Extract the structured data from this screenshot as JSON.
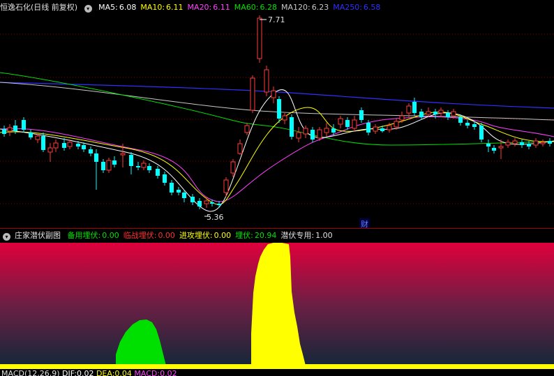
{
  "main": {
    "stock_name": "恒逸石化",
    "period": "(日线 前复权)",
    "ma": [
      {
        "label": "MA5:",
        "value": "6.08",
        "color": "#ffffff"
      },
      {
        "label": "MA10:",
        "value": "6.11",
        "color": "#ffff00"
      },
      {
        "label": "MA20:",
        "value": "6.11",
        "color": "#ff40ff"
      },
      {
        "label": "MA60:",
        "value": "6.28",
        "color": "#00e000"
      },
      {
        "label": "MA120:",
        "value": "6.23",
        "color": "#c8c8c8"
      },
      {
        "label": "MA250:",
        "value": "6.58",
        "color": "#3030ff"
      }
    ],
    "high_label": "7.71",
    "low_label": "5.36",
    "finance_marker": "财"
  },
  "sub": {
    "title": "庄家潜伏副图",
    "items": [
      {
        "label": "备用埋伏:",
        "value": "0.00",
        "color": "#00e000"
      },
      {
        "label": "临战埋伏:",
        "value": "0.00",
        "color": "#ff3030"
      },
      {
        "label": "进攻埋伏:",
        "value": "0.00",
        "color": "#ffff00"
      },
      {
        "label": "埋伏:",
        "value": "20.94",
        "color": "#00e000"
      },
      {
        "label": "潜伏专用:",
        "value": "1.00",
        "color": "#e0e0e0"
      }
    ]
  },
  "macd": {
    "title": "MACD(12,26,9)",
    "dif_label": "DIF:",
    "dif_value": "0.02",
    "dea_label": "DEA:",
    "dea_value": "0.04",
    "macd_label": "MACD:",
    "macd_value": "0.02"
  },
  "colors": {
    "up": "#ff3c3c",
    "down": "#00ffff",
    "grid": "#800000"
  }
}
